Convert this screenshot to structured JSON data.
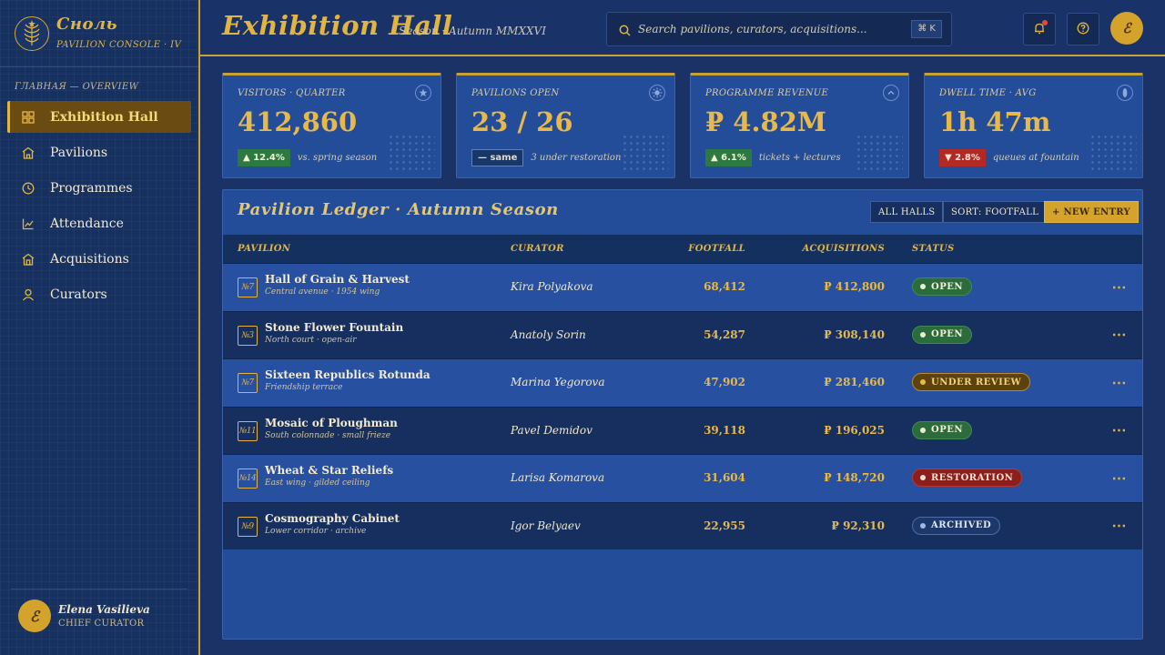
{
  "brand": {
    "name": "Сноль",
    "subtitle": "PAVILION CONSOLE · IV"
  },
  "sidebar": {
    "section_label": "ГЛАВНАЯ — OVERVIEW",
    "items": [
      {
        "label": "Exhibition Hall",
        "icon": "grid-icon",
        "active": true
      },
      {
        "label": "Pavilions",
        "icon": "pavilion-icon"
      },
      {
        "label": "Programmes",
        "icon": "clock-icon"
      },
      {
        "label": "Attendance",
        "icon": "chart-icon"
      },
      {
        "label": "Acquisitions",
        "icon": "acquisitions-icon"
      },
      {
        "label": "Curators",
        "icon": "user-icon"
      }
    ]
  },
  "user": {
    "initial": "ℰ",
    "name": "Elena Vasilieva",
    "role": "CHIEF CURATOR"
  },
  "header": {
    "title": "Exhibition Hall",
    "subtitle": "Season · Autumn MMXXVI",
    "search_placeholder": "Search pavilions, curators, acquisitions...",
    "shortcut": "⌘ K",
    "avatar_initial": "ℰ"
  },
  "kpis": [
    {
      "label": "VISITORS · QUARTER",
      "value": "412,860",
      "delta": "▲ 12.4%",
      "delta_type": "up",
      "note": "vs. spring season",
      "icon": "star-icon"
    },
    {
      "label": "PAVILIONS OPEN",
      "value": "23 / 26",
      "delta": "— same",
      "delta_type": "same",
      "note": "3 under restoration",
      "icon": "sun-icon"
    },
    {
      "label": "PROGRAMME REVENUE",
      "value": "₽ 4.82M",
      "delta": "▲ 6.1%",
      "delta_type": "up",
      "note": "tickets + lectures",
      "icon": "chevron-up-icon"
    },
    {
      "label": "DWELL TIME · AVG",
      "value": "1h 47m",
      "delta": "▼ 2.8%",
      "delta_type": "down",
      "note": "queues at fountain",
      "icon": "wheat-icon"
    }
  ],
  "ledger": {
    "title": "Pavilion Ledger · Autumn Season",
    "filter_label": "ALL HALLS",
    "sort_label": "SORT: FOOTFALL",
    "new_label": "+ NEW ENTRY",
    "columns": {
      "pavilion": "PAVILION",
      "curator": "CURATOR",
      "footfall": "FOOTFALL",
      "acquisitions": "ACQUISITIONS",
      "status": "STATUS"
    },
    "rows": [
      {
        "code": "№7",
        "name": "Hall of Grain & Harvest",
        "sub": "Central avenue · 1954 wing",
        "curator": "Kira Polyakova",
        "footfall": "68,412",
        "acquisitions": "₽ 412,800",
        "status": "OPEN",
        "status_type": "open"
      },
      {
        "code": "№3",
        "name": "Stone Flower Fountain",
        "sub": "North court · open-air",
        "curator": "Anatoly Sorin",
        "footfall": "54,287",
        "acquisitions": "₽ 308,140",
        "status": "OPEN",
        "status_type": "open"
      },
      {
        "code": "№7",
        "name": "Sixteen Republics Rotunda",
        "sub": "Friendship terrace",
        "curator": "Marina Yegorova",
        "footfall": "47,902",
        "acquisitions": "₽ 281,460",
        "status": "UNDER REVIEW",
        "status_type": "review"
      },
      {
        "code": "№11",
        "name": "Mosaic of Ploughman",
        "sub": "South colonnade · small frieze",
        "curator": "Pavel Demidov",
        "footfall": "39,118",
        "acquisitions": "₽ 196,025",
        "status": "OPEN",
        "status_type": "open"
      },
      {
        "code": "№14",
        "name": "Wheat & Star Reliefs",
        "sub": "East wing · gilded ceiling",
        "curator": "Larisa Komarova",
        "footfall": "31,604",
        "acquisitions": "₽ 148,720",
        "status": "RESTORATION",
        "status_type": "restoration"
      },
      {
        "code": "№9",
        "name": "Cosmography Cabinet",
        "sub": "Lower corridor · archive",
        "curator": "Igor Belyaev",
        "footfall": "22,955",
        "acquisitions": "₽ 92,310",
        "status": "ARCHIVED",
        "status_type": "archived"
      }
    ]
  },
  "colors": {
    "accent": "#e2b441",
    "background": "#1a3266",
    "panel": "#234d98"
  }
}
